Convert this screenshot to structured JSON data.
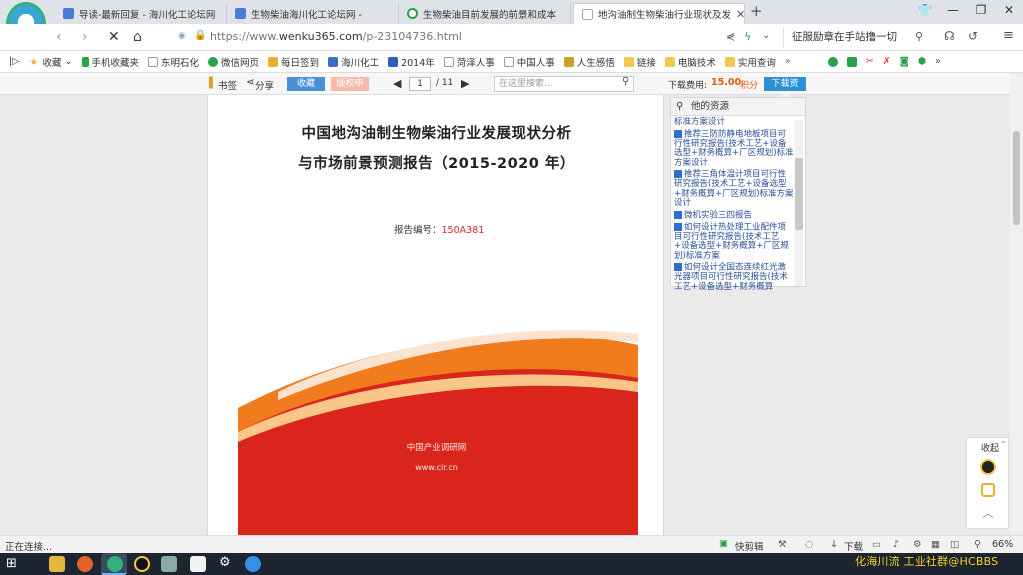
{
  "tabs": [
    {
      "label": "导读-最新回复 - 海川化工论坛网",
      "active": false
    },
    {
      "label": "生物柴油海川化工论坛网 -",
      "active": false
    },
    {
      "label": "生物柴油目前发展的前景和成本",
      "active": false
    },
    {
      "label": "地沟油制生物柴油行业现状及发",
      "active": true
    }
  ],
  "address": {
    "url_prefix": "https://www.",
    "url_host": "wenku365.com",
    "url_path": "/p-23104736.html",
    "search_text": "征服励章在手站撸一切"
  },
  "bookmarks": [
    "收藏",
    "手机收藏夹",
    "东明石化",
    "微信网页",
    "每日签到",
    "海川化工",
    "2014年",
    "菏泽人事",
    "中国人事",
    "人生感悟",
    "链接",
    "电脑技术",
    "实用查询"
  ],
  "viewer": {
    "bookmark_label": "书签",
    "share_label": "分享",
    "fav_btn": "收藏",
    "report_btn": "版权申诉",
    "page_current": "1",
    "page_total": "/ 11",
    "search_placeholder": "在这里搜索...",
    "cost_label": "下载费用:",
    "cost_value": "15.00",
    "cost_unit": "积分",
    "download_btn": "下载资源"
  },
  "document": {
    "title_line1": "中国地沟油制生物柴油行业发展现状分析",
    "title_line2": "与市场前景预测报告（2015-2020 年）",
    "report_label": "报告编号：",
    "report_no": "150A381",
    "cover_org": "中国产业调研网",
    "cover_url": "www.cir.cn"
  },
  "sidebar": {
    "title": "他的资源",
    "top_fragment": "标准方案设计",
    "items": [
      "推荐三防防静电地板项目可行性研究报告(技术工艺+设备选型+财务概算+厂区规划)标准方案设计",
      "推荐三角体温计项目可行性研究报告(技术工艺+设备选型+财务概算+厂区规划)标准方案设计",
      "微机实验三四报告",
      "如何设计热处理工业配件项目可行性研究报告(技术工艺+设备选型+财务概算+厂区规划)标准方案",
      "如何设计全国态连续红光激光器项目可行性研究报告(技术工艺+设备选型+财务概算"
    ]
  },
  "float_panel": {
    "collapse_label": "收起"
  },
  "status": {
    "left": "正在连接...",
    "cut_label": "快剪辑",
    "download_label": "下载",
    "zoom": "66%"
  },
  "watermark": "化海川流 工业社群@HCBBS"
}
